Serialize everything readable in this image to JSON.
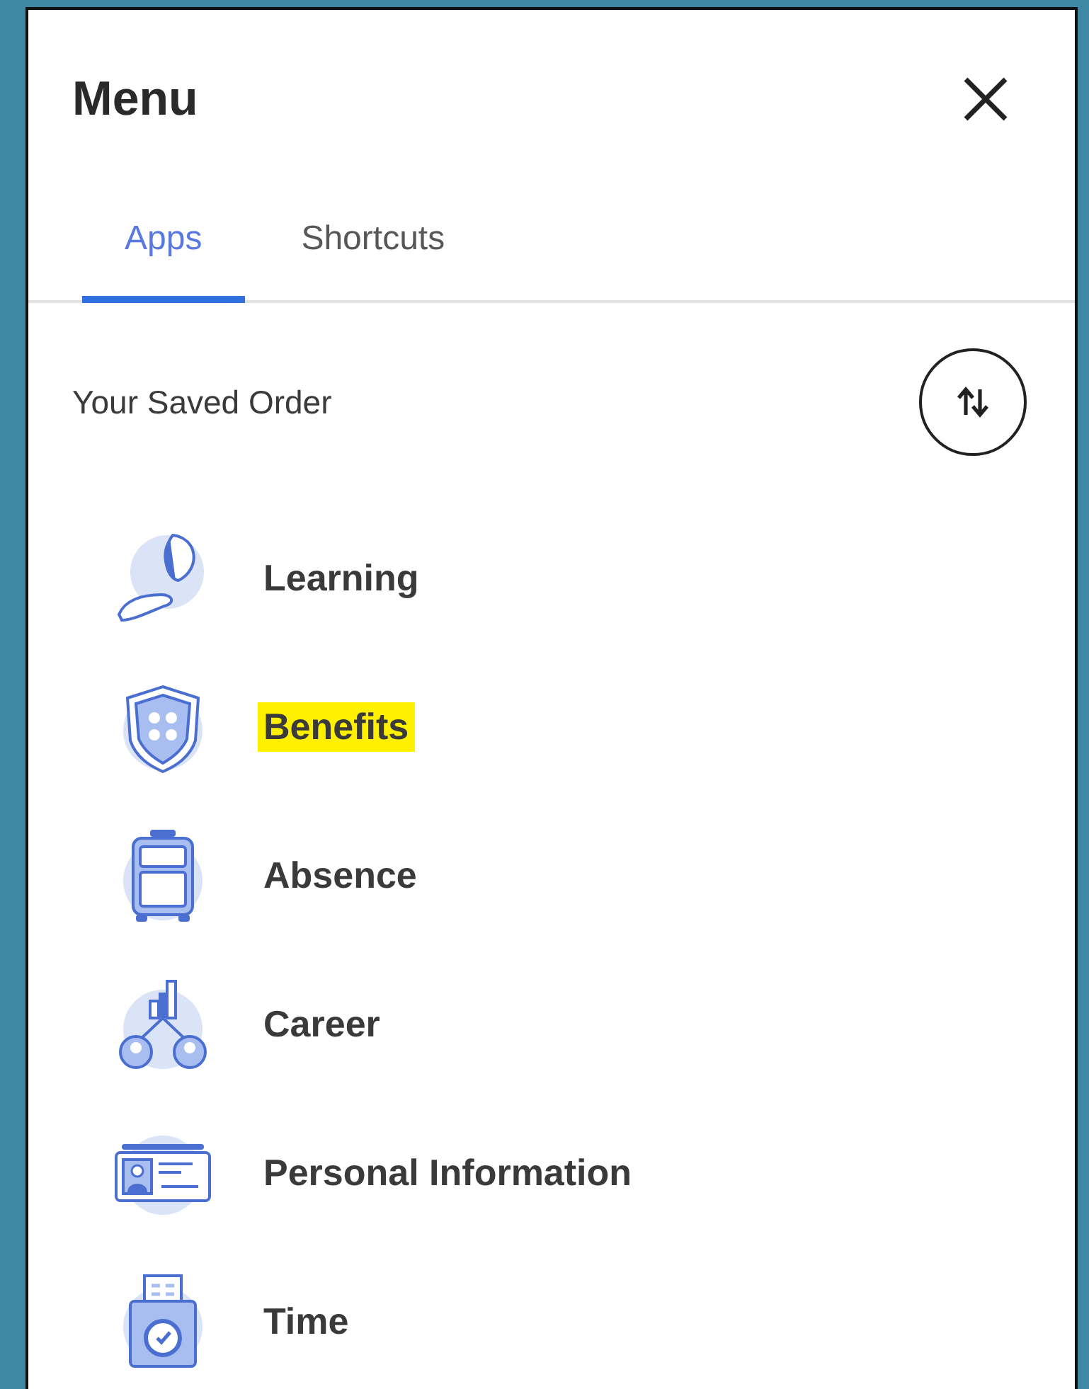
{
  "header": {
    "title": "Menu"
  },
  "tabs": [
    {
      "label": "Apps",
      "selected": true
    },
    {
      "label": "Shortcuts",
      "selected": false
    }
  ],
  "section": {
    "title": "Your Saved Order"
  },
  "apps": [
    {
      "label": "Learning",
      "kind": "learning",
      "highlighted": false
    },
    {
      "label": "Benefits",
      "kind": "benefits",
      "highlighted": true
    },
    {
      "label": "Absence",
      "kind": "absence",
      "highlighted": false
    },
    {
      "label": "Career",
      "kind": "career",
      "highlighted": false
    },
    {
      "label": "Personal Information",
      "kind": "personal",
      "highlighted": false
    },
    {
      "label": "Time",
      "kind": "time",
      "highlighted": false
    }
  ]
}
